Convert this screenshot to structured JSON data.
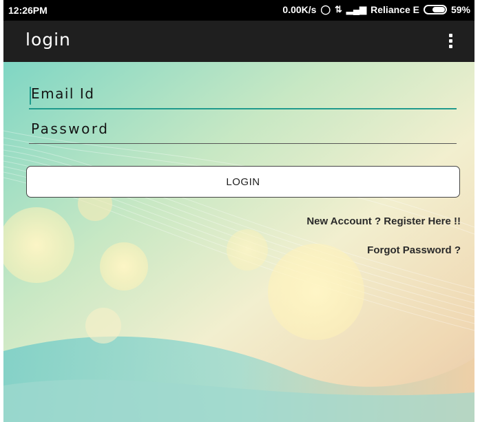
{
  "status_bar": {
    "time": "12:26PM",
    "speed": "0.00K/s",
    "carrier": "Reliance E",
    "battery": "59%",
    "battery_level": 0.59,
    "icons": [
      "alarm-off-icon",
      "data-transfer-icon",
      "signal-icon",
      "battery-icon"
    ]
  },
  "app_bar": {
    "title": "login",
    "menu_icon": "overflow-menu-icon"
  },
  "form": {
    "email_placeholder": "Email Id",
    "email_value": "",
    "password_placeholder": "Password",
    "password_value": "",
    "login_label": "LOGIN",
    "register_link": "New Account ? Register Here !!",
    "forgot_link": "Forgot Password ?"
  },
  "colors": {
    "accent": "#1f9a8c",
    "app_bar": "#1f1f1f",
    "status_bar": "#000000"
  }
}
